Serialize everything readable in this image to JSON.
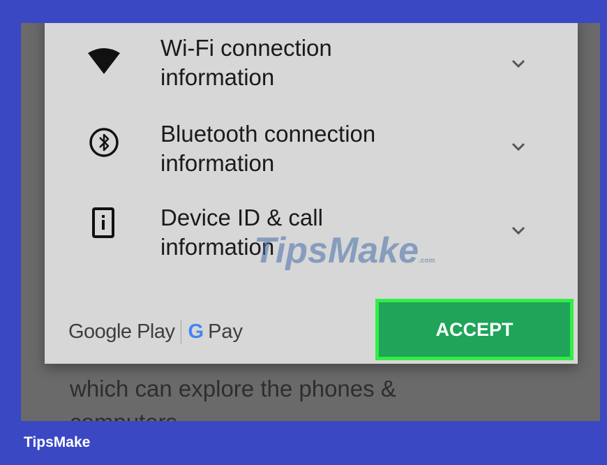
{
  "permissions": [
    {
      "icon": "wifi-icon",
      "line1": "Wi-Fi connection",
      "line2": "information"
    },
    {
      "icon": "bluetooth-icon",
      "line1": "Bluetooth connection",
      "line2": "information"
    },
    {
      "icon": "device-info-icon",
      "line1": "Device ID & call",
      "line2": "information"
    }
  ],
  "footer": {
    "google_play": "Google Play",
    "gpay_g": "G",
    "gpay_text": "Pay",
    "accept_label": "ACCEPT"
  },
  "background_text": {
    "line1": "which can explore the phones &",
    "line2": "computers"
  },
  "watermark": {
    "text": "TipsMake",
    "suffix": ".com"
  },
  "brand": "TipsMake",
  "colors": {
    "frame": "#3a48c4",
    "accept": "#1fa45a",
    "accept_border": "#31ee45"
  }
}
